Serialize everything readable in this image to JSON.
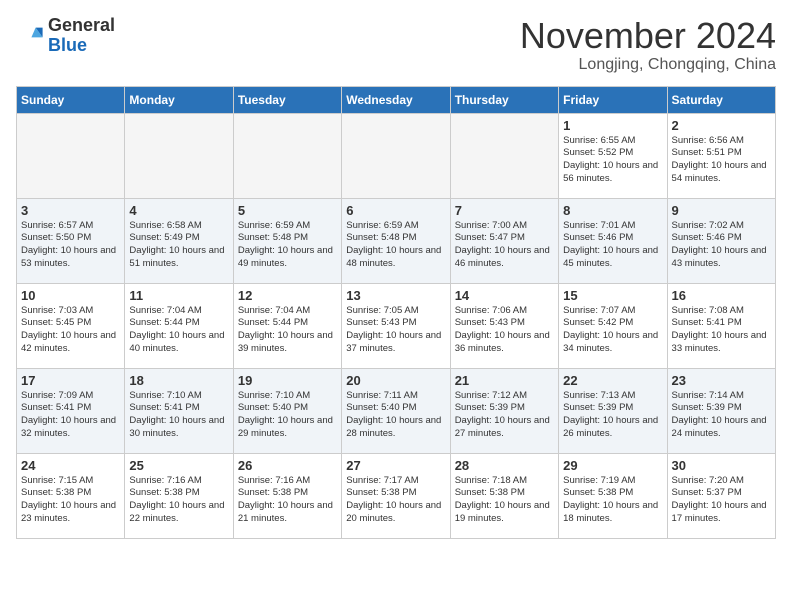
{
  "header": {
    "logo_general": "General",
    "logo_blue": "Blue",
    "month": "November 2024",
    "location": "Longjing, Chongqing, China"
  },
  "weekdays": [
    "Sunday",
    "Monday",
    "Tuesday",
    "Wednesday",
    "Thursday",
    "Friday",
    "Saturday"
  ],
  "weeks": [
    [
      {
        "day": "",
        "empty": true
      },
      {
        "day": "",
        "empty": true
      },
      {
        "day": "",
        "empty": true
      },
      {
        "day": "",
        "empty": true
      },
      {
        "day": "",
        "empty": true
      },
      {
        "day": "1",
        "sunrise": "6:55 AM",
        "sunset": "5:52 PM",
        "daylight": "10 hours and 56 minutes."
      },
      {
        "day": "2",
        "sunrise": "6:56 AM",
        "sunset": "5:51 PM",
        "daylight": "10 hours and 54 minutes."
      }
    ],
    [
      {
        "day": "3",
        "sunrise": "6:57 AM",
        "sunset": "5:50 PM",
        "daylight": "10 hours and 53 minutes."
      },
      {
        "day": "4",
        "sunrise": "6:58 AM",
        "sunset": "5:49 PM",
        "daylight": "10 hours and 51 minutes."
      },
      {
        "day": "5",
        "sunrise": "6:59 AM",
        "sunset": "5:48 PM",
        "daylight": "10 hours and 49 minutes."
      },
      {
        "day": "6",
        "sunrise": "6:59 AM",
        "sunset": "5:48 PM",
        "daylight": "10 hours and 48 minutes."
      },
      {
        "day": "7",
        "sunrise": "7:00 AM",
        "sunset": "5:47 PM",
        "daylight": "10 hours and 46 minutes."
      },
      {
        "day": "8",
        "sunrise": "7:01 AM",
        "sunset": "5:46 PM",
        "daylight": "10 hours and 45 minutes."
      },
      {
        "day": "9",
        "sunrise": "7:02 AM",
        "sunset": "5:46 PM",
        "daylight": "10 hours and 43 minutes."
      }
    ],
    [
      {
        "day": "10",
        "sunrise": "7:03 AM",
        "sunset": "5:45 PM",
        "daylight": "10 hours and 42 minutes."
      },
      {
        "day": "11",
        "sunrise": "7:04 AM",
        "sunset": "5:44 PM",
        "daylight": "10 hours and 40 minutes."
      },
      {
        "day": "12",
        "sunrise": "7:04 AM",
        "sunset": "5:44 PM",
        "daylight": "10 hours and 39 minutes."
      },
      {
        "day": "13",
        "sunrise": "7:05 AM",
        "sunset": "5:43 PM",
        "daylight": "10 hours and 37 minutes."
      },
      {
        "day": "14",
        "sunrise": "7:06 AM",
        "sunset": "5:43 PM",
        "daylight": "10 hours and 36 minutes."
      },
      {
        "day": "15",
        "sunrise": "7:07 AM",
        "sunset": "5:42 PM",
        "daylight": "10 hours and 34 minutes."
      },
      {
        "day": "16",
        "sunrise": "7:08 AM",
        "sunset": "5:41 PM",
        "daylight": "10 hours and 33 minutes."
      }
    ],
    [
      {
        "day": "17",
        "sunrise": "7:09 AM",
        "sunset": "5:41 PM",
        "daylight": "10 hours and 32 minutes."
      },
      {
        "day": "18",
        "sunrise": "7:10 AM",
        "sunset": "5:41 PM",
        "daylight": "10 hours and 30 minutes."
      },
      {
        "day": "19",
        "sunrise": "7:10 AM",
        "sunset": "5:40 PM",
        "daylight": "10 hours and 29 minutes."
      },
      {
        "day": "20",
        "sunrise": "7:11 AM",
        "sunset": "5:40 PM",
        "daylight": "10 hours and 28 minutes."
      },
      {
        "day": "21",
        "sunrise": "7:12 AM",
        "sunset": "5:39 PM",
        "daylight": "10 hours and 27 minutes."
      },
      {
        "day": "22",
        "sunrise": "7:13 AM",
        "sunset": "5:39 PM",
        "daylight": "10 hours and 26 minutes."
      },
      {
        "day": "23",
        "sunrise": "7:14 AM",
        "sunset": "5:39 PM",
        "daylight": "10 hours and 24 minutes."
      }
    ],
    [
      {
        "day": "24",
        "sunrise": "7:15 AM",
        "sunset": "5:38 PM",
        "daylight": "10 hours and 23 minutes."
      },
      {
        "day": "25",
        "sunrise": "7:16 AM",
        "sunset": "5:38 PM",
        "daylight": "10 hours and 22 minutes."
      },
      {
        "day": "26",
        "sunrise": "7:16 AM",
        "sunset": "5:38 PM",
        "daylight": "10 hours and 21 minutes."
      },
      {
        "day": "27",
        "sunrise": "7:17 AM",
        "sunset": "5:38 PM",
        "daylight": "10 hours and 20 minutes."
      },
      {
        "day": "28",
        "sunrise": "7:18 AM",
        "sunset": "5:38 PM",
        "daylight": "10 hours and 19 minutes."
      },
      {
        "day": "29",
        "sunrise": "7:19 AM",
        "sunset": "5:38 PM",
        "daylight": "10 hours and 18 minutes."
      },
      {
        "day": "30",
        "sunrise": "7:20 AM",
        "sunset": "5:37 PM",
        "daylight": "10 hours and 17 minutes."
      }
    ]
  ],
  "labels": {
    "sunrise_prefix": "Sunrise: ",
    "sunset_prefix": "Sunset: ",
    "daylight_prefix": "Daylight: "
  }
}
